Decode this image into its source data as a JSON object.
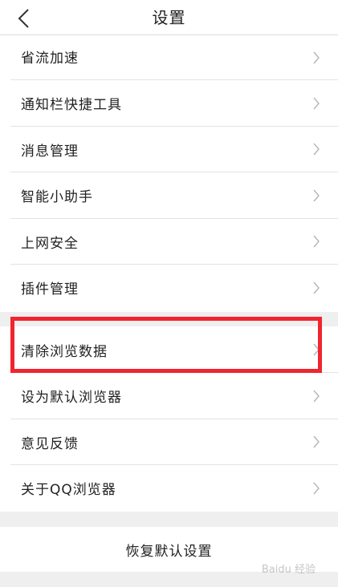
{
  "header": {
    "title": "设置",
    "back_icon": "chevron-left-icon"
  },
  "group1": {
    "items": [
      {
        "label": "省流加速"
      },
      {
        "label": "通知栏快捷工具"
      },
      {
        "label": "消息管理"
      },
      {
        "label": "智能小助手"
      },
      {
        "label": "上网安全"
      },
      {
        "label": "插件管理"
      }
    ]
  },
  "group2": {
    "items": [
      {
        "label": "清除浏览数据"
      },
      {
        "label": "设为默认浏览器"
      },
      {
        "label": "意见反馈"
      },
      {
        "label": "关于QQ浏览器"
      }
    ]
  },
  "restore": {
    "label": "恢复默认设置"
  },
  "highlight_color": "#f0252f",
  "watermark": "Baidu 经验"
}
